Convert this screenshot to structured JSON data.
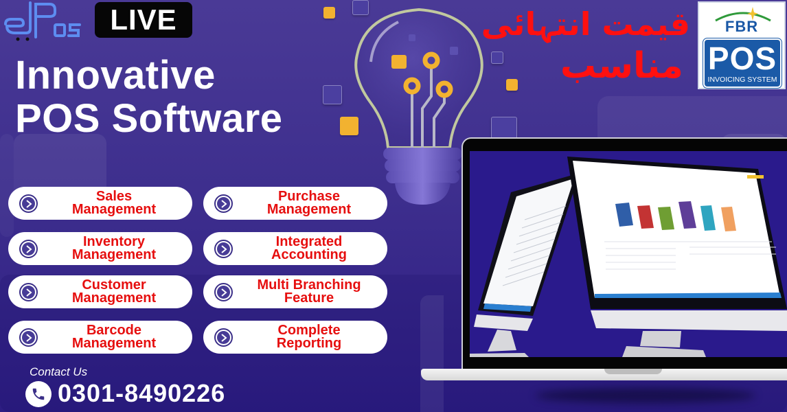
{
  "brand": {
    "logo_text": "epos",
    "live_label": "LIVE"
  },
  "headline": {
    "line1": "Innovative",
    "line2": "POS Software"
  },
  "features": [
    {
      "line1": "Sales",
      "line2": "Management"
    },
    {
      "line1": "Purchase",
      "line2": "Management"
    },
    {
      "line1": "Inventory",
      "line2": "Management"
    },
    {
      "line1": "Integrated",
      "line2": "Accounting"
    },
    {
      "line1": "Customer",
      "line2": "Management"
    },
    {
      "line1": "Multi Branching",
      "line2": "Feature"
    },
    {
      "line1": "Barcode",
      "line2": "Management"
    },
    {
      "line1": "Complete",
      "line2": "Reporting"
    }
  ],
  "feature_icon": "chevron-right-circle-icon",
  "contact": {
    "label": "Contact Us",
    "phone": "0301-8490226",
    "icon": "phone-icon"
  },
  "urdu_tagline": {
    "line1": "قیمت انتہائی",
    "line2": "مناسب"
  },
  "fbr_badge": {
    "top": "FBR",
    "main": "POS",
    "sub": "INVOICING SYSTEM"
  },
  "colors": {
    "background": "#3e2f8e",
    "feature_text": "#e60f0f",
    "urdu_text": "#ff1010",
    "fbr_blue": "#1b5aa7",
    "accent_orange": "#f2b230"
  }
}
